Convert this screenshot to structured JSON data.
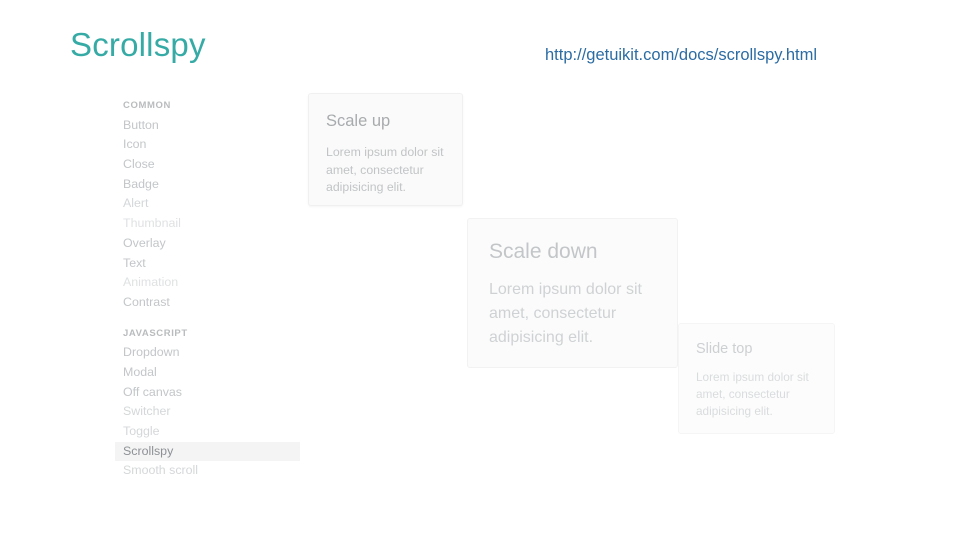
{
  "header": {
    "title": "Scrollspy",
    "url": "http://getuikit.com/docs/scrollspy.html",
    "title_color": "#36aba6",
    "url_color": "#2b6ca3"
  },
  "sidebar": {
    "groups": [
      {
        "heading": "COMMON",
        "items": [
          {
            "label": "Button",
            "active": false
          },
          {
            "label": "Icon",
            "active": false
          },
          {
            "label": "Close",
            "active": false
          },
          {
            "label": "Badge",
            "active": false
          },
          {
            "label": "Alert",
            "active": false
          },
          {
            "label": "Thumbnail",
            "active": false
          },
          {
            "label": "Overlay",
            "active": false
          },
          {
            "label": "Text",
            "active": false
          },
          {
            "label": "Animation",
            "active": false
          },
          {
            "label": "Contrast",
            "active": false
          }
        ]
      },
      {
        "heading": "JAVASCRIPT",
        "items": [
          {
            "label": "Dropdown",
            "active": false
          },
          {
            "label": "Modal",
            "active": false
          },
          {
            "label": "Off canvas",
            "active": false
          },
          {
            "label": "Switcher",
            "active": false
          },
          {
            "label": "Toggle",
            "active": false
          },
          {
            "label": "Scrollspy",
            "active": true
          },
          {
            "label": "Smooth scroll",
            "active": false
          }
        ]
      }
    ],
    "active_highlight_color": "#f4f4f4"
  },
  "cards": [
    {
      "title": "Scale up",
      "body": "Lorem ipsum dolor sit amet, consectetur adipisicing elit."
    },
    {
      "title": "Scale down",
      "body": "Lorem ipsum dolor sit amet, consectetur adipisicing elit."
    },
    {
      "title": "Slide top",
      "body": "Lorem ipsum dolor sit amet, consectetur adipisicing elit."
    }
  ]
}
